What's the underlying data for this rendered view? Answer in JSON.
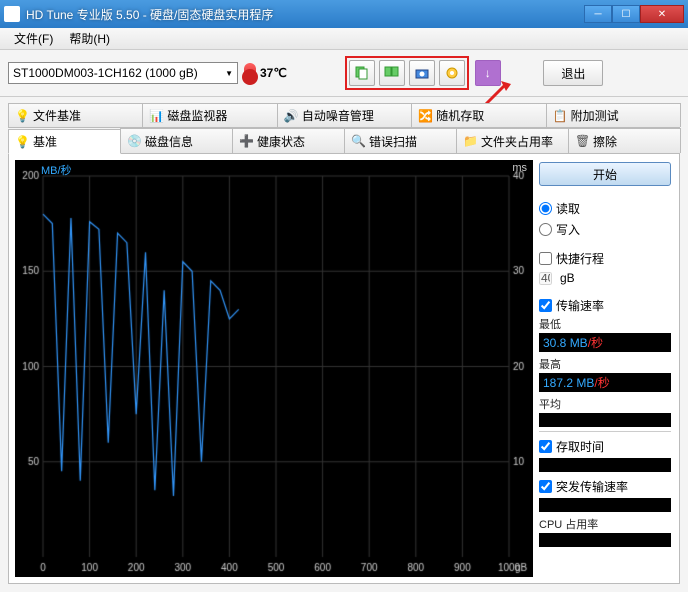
{
  "window": {
    "title": "HD Tune 专业版 5.50 - 硬盘/固态硬盘实用程序"
  },
  "menu": {
    "file": "文件(F)",
    "help": "帮助(H)"
  },
  "toolbar": {
    "drive": "ST1000DM003-1CH162 (1000 gB)",
    "temperature": "37℃",
    "exit": "退出"
  },
  "tabs_row1": [
    {
      "label": "文件基准"
    },
    {
      "label": "磁盘监视器"
    },
    {
      "label": "自动噪音管理"
    },
    {
      "label": "随机存取"
    },
    {
      "label": "附加测试"
    }
  ],
  "tabs_row2": [
    {
      "label": "基准",
      "active": true
    },
    {
      "label": "磁盘信息"
    },
    {
      "label": "健康状态"
    },
    {
      "label": "错误扫描"
    },
    {
      "label": "文件夹占用率"
    },
    {
      "label": "擦除"
    }
  ],
  "side": {
    "start": "开始",
    "read": "读取",
    "write": "写入",
    "fast_stroke": "快捷行程",
    "fast_value": "40",
    "fast_unit": "gB",
    "transfer_rate": "传输速率",
    "min_label": "最低",
    "min_value": "30.8 MB/秒",
    "max_label": "最高",
    "max_value": "187.2 MB/秒",
    "avg_label": "平均",
    "access_time": "存取时间",
    "burst_rate": "突发传输速率",
    "cpu_usage": "CPU 占用率"
  },
  "chart_data": {
    "type": "line",
    "title": "",
    "xlabel": "gB",
    "ylabel_left": "MB/秒",
    "ylabel_right": "ms",
    "x": [
      0,
      20,
      40,
      60,
      80,
      100,
      120,
      140,
      160,
      180,
      200,
      220,
      240,
      260,
      280,
      300,
      320,
      340,
      360,
      380,
      400,
      420
    ],
    "y": [
      180,
      175,
      45,
      178,
      40,
      176,
      172,
      60,
      170,
      165,
      75,
      160,
      35,
      140,
      32,
      155,
      150,
      50,
      145,
      140,
      125,
      130
    ],
    "xlim": [
      0,
      1000
    ],
    "ylim_left": [
      0,
      200
    ],
    "ylim_right": [
      0,
      40
    ],
    "xticks": [
      0,
      100,
      200,
      300,
      400,
      500,
      600,
      700,
      800,
      900,
      1000
    ],
    "yticks_left": [
      50,
      100,
      150,
      200
    ],
    "yticks_right": [
      10,
      20,
      30,
      40
    ],
    "series_color": "#3399ff"
  }
}
